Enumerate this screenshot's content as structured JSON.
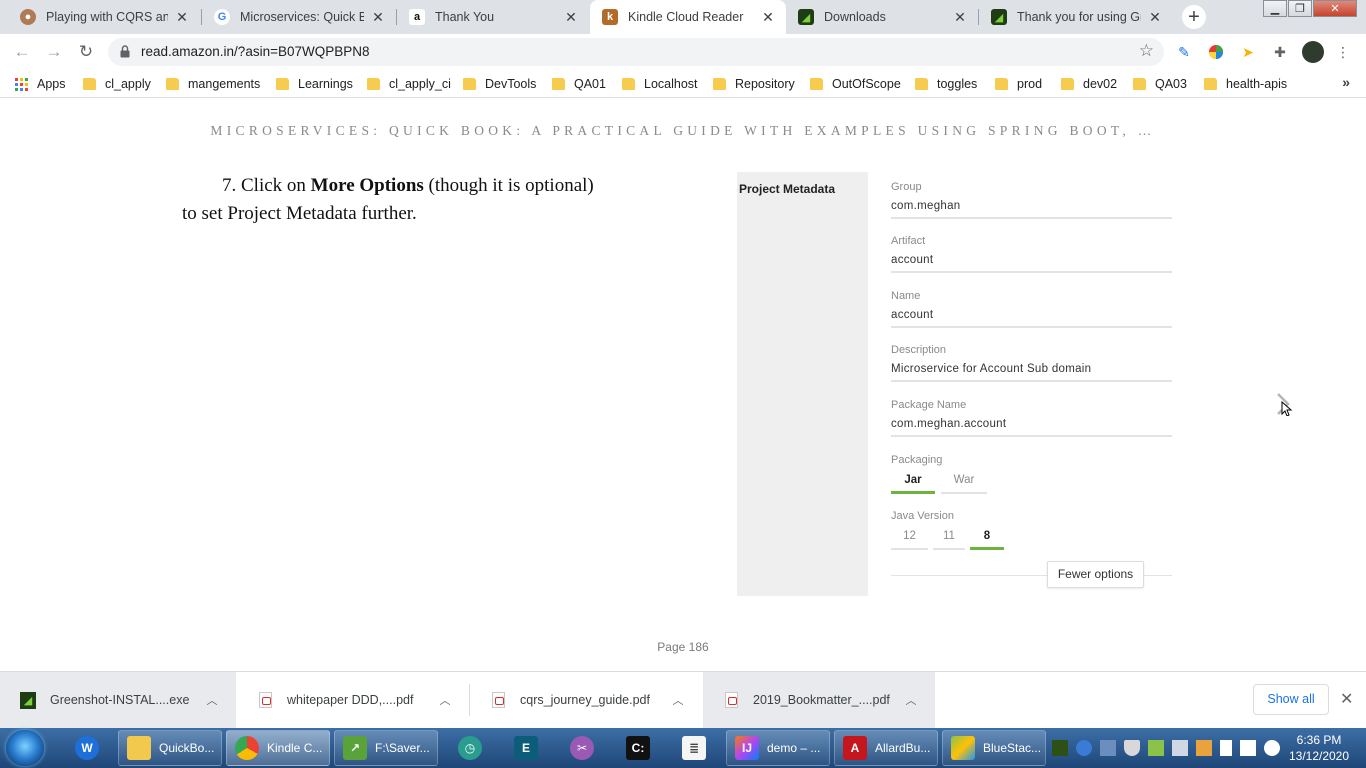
{
  "browser": {
    "tabs": [
      {
        "title": "Playing with CQRS and E",
        "favicon": "avatar-icon",
        "active": false
      },
      {
        "title": "Microservices: Quick Boo",
        "favicon": "google-icon",
        "active": false
      },
      {
        "title": "Thank You",
        "favicon": "amazon-icon",
        "active": false
      },
      {
        "title": "Kindle Cloud Reader",
        "favicon": "kindle-icon",
        "active": true
      },
      {
        "title": "Downloads",
        "favicon": "greenshot-icon",
        "active": false
      },
      {
        "title": "Thank you for using Gree",
        "favicon": "greenshot-icon",
        "active": false
      }
    ],
    "address": {
      "url": "read.amazon.in/?asin=B07WQPBPN8"
    },
    "bookmarks": [
      {
        "label": "Apps",
        "kind": "apps"
      },
      {
        "label": "cl_apply",
        "kind": "folder"
      },
      {
        "label": "mangements",
        "kind": "folder"
      },
      {
        "label": "Learnings",
        "kind": "folder"
      },
      {
        "label": "cl_apply_ci",
        "kind": "folder"
      },
      {
        "label": "DevTools",
        "kind": "folder"
      },
      {
        "label": "QA01",
        "kind": "folder"
      },
      {
        "label": "Localhost",
        "kind": "folder"
      },
      {
        "label": "Repository",
        "kind": "folder"
      },
      {
        "label": "OutOfScope",
        "kind": "folder"
      },
      {
        "label": "toggles",
        "kind": "folder"
      },
      {
        "label": "prod",
        "kind": "folder"
      },
      {
        "label": "dev02",
        "kind": "folder"
      },
      {
        "label": "QA03",
        "kind": "folder"
      },
      {
        "label": "health-apis",
        "kind": "folder"
      }
    ],
    "more_bookmarks": "»"
  },
  "reader": {
    "book_title": "MICROSERVICES: QUICK BOOK: A PRACTICAL GUIDE WITH EXAMPLES USING SPRING BOOT, …",
    "paragraph": {
      "prefix": "7. Click on ",
      "bold": "More Options",
      "suffix": " (though it is optional) to set Project Metadata further."
    },
    "figure": {
      "section_label": "Project Metadata",
      "fields": [
        {
          "label": "Group",
          "value": "com.meghan"
        },
        {
          "label": "Artifact",
          "value": "account"
        },
        {
          "label": "Name",
          "value": "account"
        },
        {
          "label": "Description",
          "value": "Microservice for Account Sub domain"
        },
        {
          "label": "Package Name",
          "value": "com.meghan.account"
        }
      ],
      "packaging": {
        "label": "Packaging",
        "options": [
          "Jar",
          "War"
        ],
        "selected": "Jar"
      },
      "java_version": {
        "label": "Java Version",
        "options": [
          "12",
          "11",
          "8"
        ],
        "selected": "8"
      },
      "fewer_options": "Fewer options",
      "accent_color": "#6db33f"
    },
    "page_label": "Page 186"
  },
  "downloads": {
    "items": [
      {
        "name": "Greenshot-INSTAL....exe",
        "icon": "greenshot-icon"
      },
      {
        "name": "whitepaper DDD,....pdf",
        "icon": "pdf-icon"
      },
      {
        "name": "cqrs_journey_guide.pdf",
        "icon": "pdf-icon"
      },
      {
        "name": "2019_Bookmatter_....pdf",
        "icon": "pdf-icon"
      }
    ],
    "show_all": "Show all"
  },
  "taskbar": {
    "items": [
      {
        "label": "",
        "icon": "edge-like-icon"
      },
      {
        "label": "QuickBo...",
        "icon": "folder-icon"
      },
      {
        "label": "Kindle C...",
        "icon": "chrome-icon"
      },
      {
        "label": "F:\\Saver...",
        "icon": "chart-icon"
      },
      {
        "label": "",
        "icon": "clock-app-icon"
      },
      {
        "label": "",
        "icon": "editor-icon"
      },
      {
        "label": "",
        "icon": "snipping-icon"
      },
      {
        "label": "",
        "icon": "terminal-icon"
      },
      {
        "label": "",
        "icon": "notes-icon"
      },
      {
        "label": "demo – ...",
        "icon": "intellij-icon"
      },
      {
        "label": "AllardBu...",
        "icon": "pdf-reader-icon"
      },
      {
        "label": "BlueStac...",
        "icon": "bluestacks-icon"
      }
    ],
    "time": "6:36 PM",
    "date": "13/12/2020"
  }
}
